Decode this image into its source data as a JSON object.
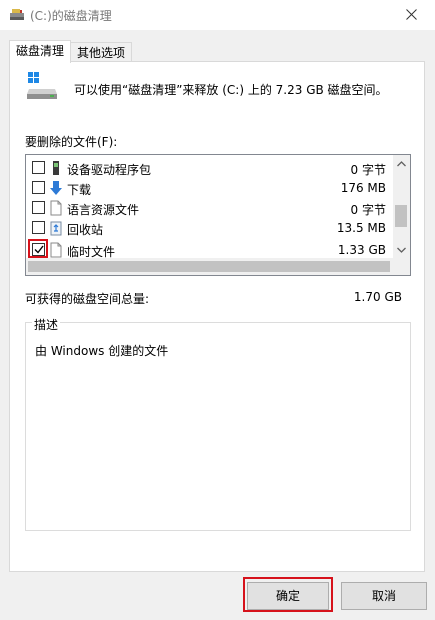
{
  "window": {
    "title": "(C:)的磁盘清理",
    "title_icon": "disk-cleanup-icon",
    "close_icon": "close-icon"
  },
  "tabs": [
    {
      "label": "磁盘清理",
      "active": true
    },
    {
      "label": "其他选项",
      "active": false
    }
  ],
  "intro": {
    "drive_icon": "drive-icon",
    "text": "可以使用“磁盘清理”来释放  (C:) 上的 7.23 GB 磁盘空间。"
  },
  "files": {
    "label": "要删除的文件(F):",
    "items": [
      {
        "name": "设备驱动程序包",
        "size": "0 字节",
        "checked": false,
        "icon": "device-driver-icon"
      },
      {
        "name": "下载",
        "size": "176 MB",
        "checked": false,
        "icon": "download-arrow-icon"
      },
      {
        "name": "语言资源文件",
        "size": "0 字节",
        "checked": false,
        "icon": "file-icon"
      },
      {
        "name": "回收站",
        "size": "13.5 MB",
        "checked": false,
        "icon": "recycle-bin-icon"
      },
      {
        "name": "临时文件",
        "size": "1.33 GB",
        "checked": true,
        "icon": "file-icon"
      }
    ]
  },
  "gain": {
    "label": "可获得的磁盘空间总量:",
    "value": "1.70 GB"
  },
  "description": {
    "legend": "描述",
    "text": "由 Windows 创建的文件"
  },
  "buttons": {
    "ok": "确定",
    "cancel": "取消"
  },
  "colors": {
    "highlight": "#d6121b",
    "download_arrow": "#2d7ad6"
  }
}
